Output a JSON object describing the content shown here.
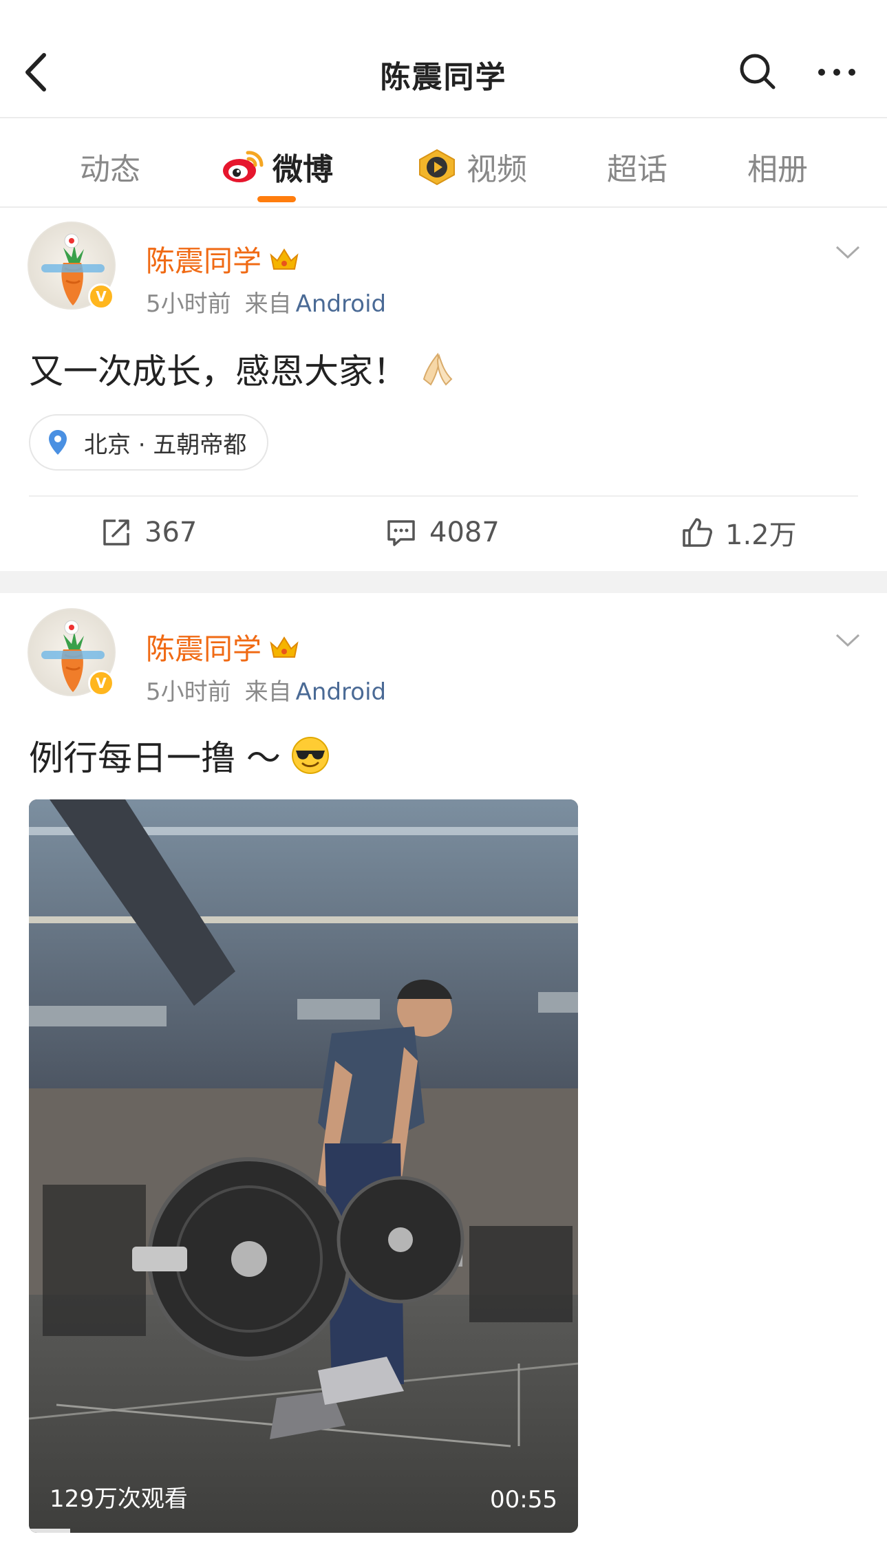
{
  "header": {
    "title": "陈震同学",
    "back_icon": "chevron-left-icon",
    "search_icon": "search-icon",
    "more_icon": "more-dots-icon"
  },
  "tabs": [
    {
      "label": "动态",
      "active": false
    },
    {
      "label": "微博",
      "active": true,
      "icon": "weibo-logo-icon"
    },
    {
      "label": "视频",
      "active": false,
      "icon": "video-badge-icon"
    },
    {
      "label": "超话",
      "active": false
    },
    {
      "label": "相册",
      "active": false
    }
  ],
  "accent_color": "#ff7d0e",
  "posts": [
    {
      "author": "陈震同学",
      "time": "5小时前",
      "source_prefix": "来自",
      "source_app": "Android",
      "text": "又一次成长，感恩大家！",
      "emoji": "folded-hands-emoji",
      "location": "北京 · 五朝帝都",
      "reposts": "367",
      "comments": "4087",
      "likes": "1.2万"
    },
    {
      "author": "陈震同学",
      "time": "5小时前",
      "source_prefix": "来自",
      "source_app": "Android",
      "text": "例行每日一撸 ～",
      "emoji": "sunglasses-face-emoji",
      "video": {
        "views": "129万次观看",
        "duration": "00:55"
      }
    }
  ]
}
